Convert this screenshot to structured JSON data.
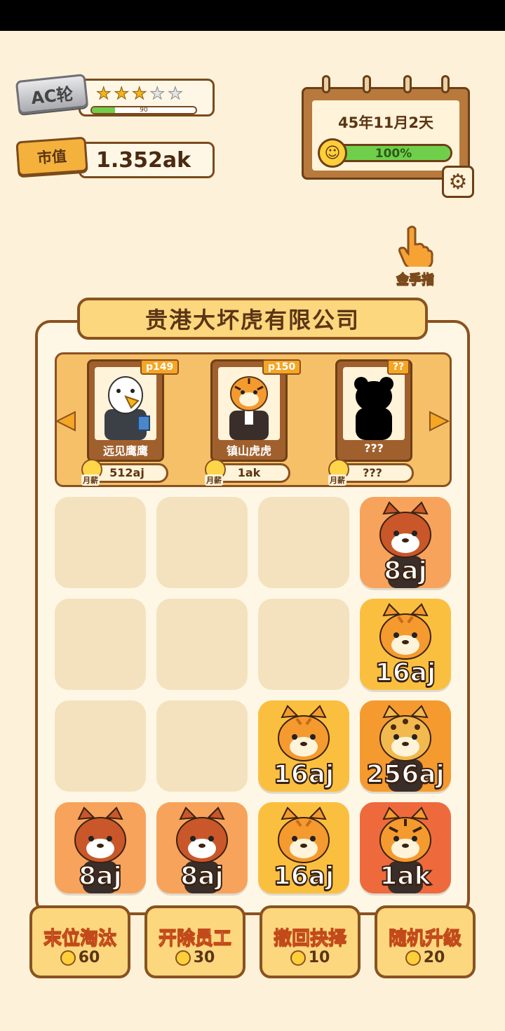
{
  "player": {
    "rank_label": "AC轮",
    "stars_filled": 3,
    "stars_total": 5,
    "xp_value": "90",
    "xp_fraction": 0.22,
    "market_value_label": "市值",
    "market_value": "1.352ak"
  },
  "calendar": {
    "date": "45年11月2天",
    "mood_percent_text": "100%",
    "mood_fraction": 1.0
  },
  "golden_finger": {
    "label": "金手指"
  },
  "company": {
    "name": "贵港大坏虎有限公司"
  },
  "staff_cards": [
    {
      "name": "远见鹰鹰",
      "tag": "p149",
      "salary": "512aj",
      "salary_label": "月薪",
      "portrait": "eagle-icon"
    },
    {
      "name": "镇山虎虎",
      "tag": "p150",
      "salary": "1ak",
      "salary_label": "月薪",
      "portrait": "tiger-icon"
    },
    {
      "name": "???",
      "tag": "??",
      "salary": "???",
      "salary_label": "月薪",
      "portrait": "silhouette-icon"
    }
  ],
  "grid": {
    "rows": [
      [
        null,
        null,
        null,
        {
          "value": "8aj",
          "animal": "red-panda",
          "color": "#f7a35c"
        }
      ],
      [
        null,
        null,
        null,
        {
          "value": "16aj",
          "animal": "cat",
          "color": "#fbbf3f"
        }
      ],
      [
        null,
        null,
        {
          "value": "16aj",
          "animal": "cat",
          "color": "#fbbf3f"
        },
        {
          "value": "256aj",
          "animal": "leopard",
          "color": "#f59a2f"
        }
      ],
      [
        {
          "value": "8aj",
          "animal": "red-panda",
          "color": "#f7a35c"
        },
        {
          "value": "8aj",
          "animal": "red-panda",
          "color": "#f7a35c"
        },
        {
          "value": "16aj",
          "animal": "cat",
          "color": "#fbbf3f"
        },
        {
          "value": "1ak",
          "animal": "tiger",
          "color": "#ee6a3c"
        }
      ]
    ]
  },
  "actions": [
    {
      "label": "末位淘汰",
      "cost": "60"
    },
    {
      "label": "开除员工",
      "cost": "30"
    },
    {
      "label": "撤回抉择",
      "cost": "10"
    },
    {
      "label": "随机升级",
      "cost": "20"
    }
  ]
}
